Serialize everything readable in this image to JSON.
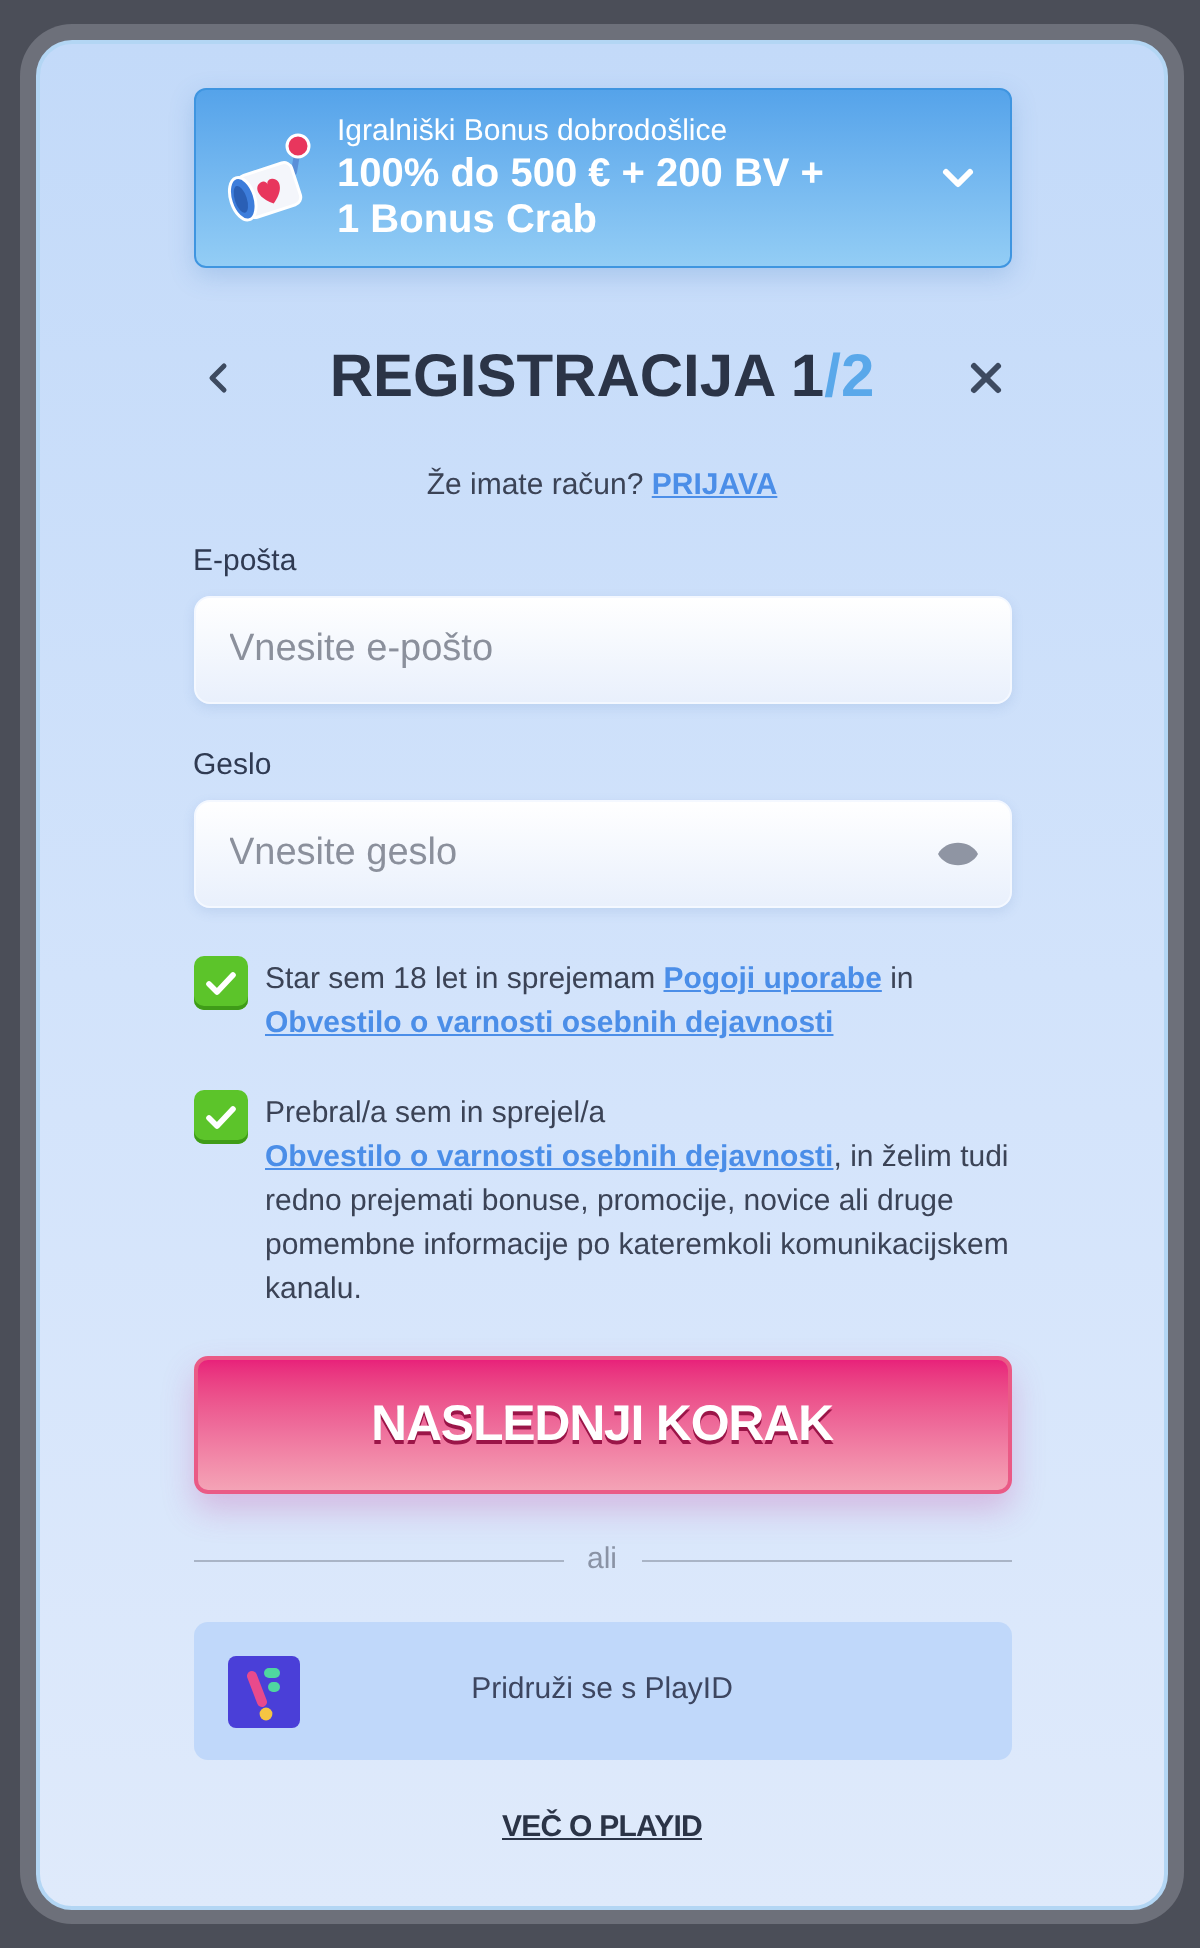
{
  "bonus_banner": {
    "title": "Igralniški Bonus dobrodošlice",
    "offer": "100% do 500 € + 200 BV + 1 Bonus Crab"
  },
  "header": {
    "title": "REGISTRACIJA 1",
    "title_accent": "/2"
  },
  "login_prompt": {
    "text": "Že imate račun? ",
    "link": "PRIJAVA"
  },
  "fields": [
    {
      "kind": "email",
      "label": "E-pošta",
      "placeholder": "Vnesite e-pošto"
    },
    {
      "kind": "password",
      "label": "Geslo",
      "placeholder": "Vnesite geslo"
    }
  ],
  "consents": [
    {
      "checked": true,
      "parts": [
        {
          "kind": "text",
          "text": "Star sem 18 let in sprejemam "
        },
        {
          "kind": "link",
          "text": "Pogoji uporabe"
        },
        {
          "kind": "text",
          "text": " in "
        },
        {
          "kind": "link",
          "text": "Obvestilo o varnosti osebnih dejavnosti"
        }
      ]
    },
    {
      "checked": true,
      "parts": [
        {
          "kind": "text",
          "text": "Prebral/a sem in sprejel/a "
        },
        {
          "kind": "link",
          "text": "Obvestilo o varnosti osebnih dejavnosti"
        },
        {
          "kind": "text",
          "text": ", in želim tudi redno prejemati bonuse, promocije, novice ali druge pomembne informacije po kateremkoli komunikacijskem kanalu."
        }
      ]
    }
  ],
  "next_button": "NASLEDNJI KORAK",
  "divider": "ali",
  "playid_button": "Pridruži se s PlayID",
  "more_link": "VEČ O PLAYID"
}
